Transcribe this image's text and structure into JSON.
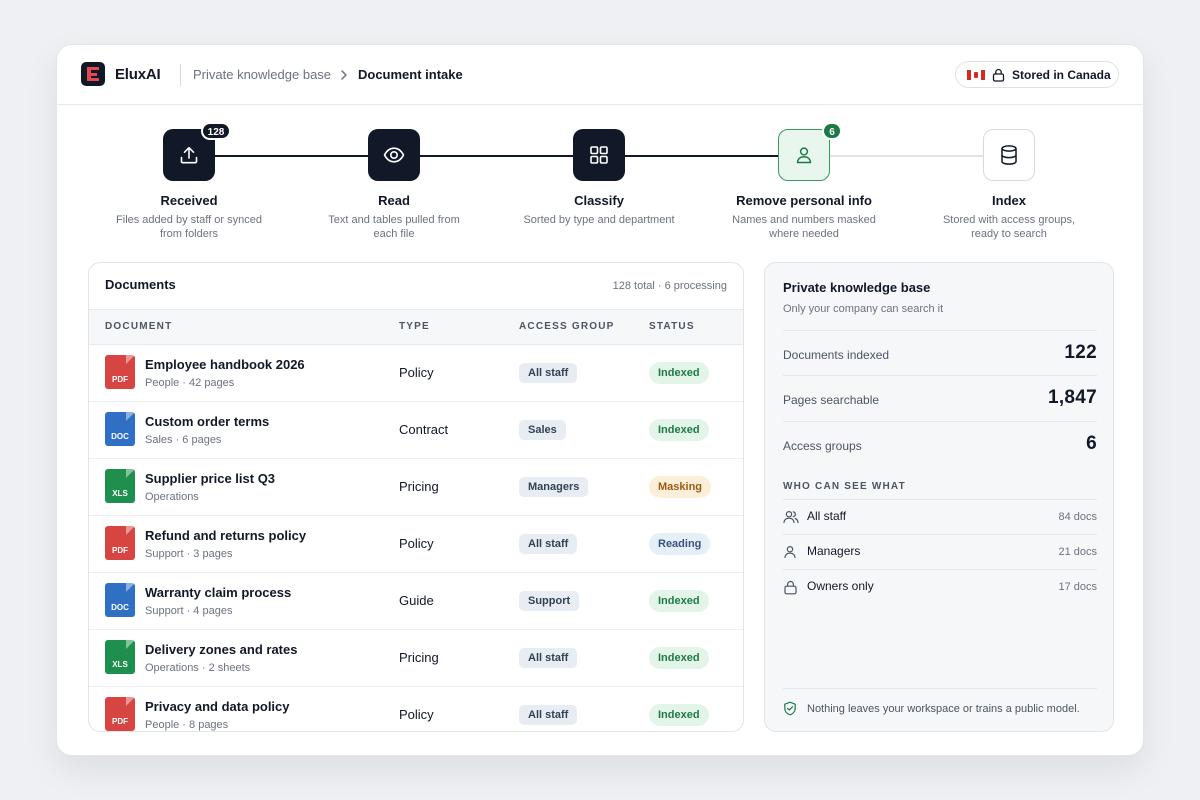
{
  "header": {
    "brand": "EluxAI",
    "breadcrumb": [
      "Private knowledge base",
      "Document intake"
    ],
    "region_badge": "Stored in Canada",
    "logo_icon": "eluxai-logo-icon",
    "flag_icon": "canada-flag-icon"
  },
  "pipeline": {
    "steps": [
      {
        "title": "Received",
        "desc1": "Files added by staff or synced",
        "desc2": "from folders",
        "badge": "128",
        "icon": "upload-icon",
        "state": "done"
      },
      {
        "title": "Read",
        "desc1": "Text and tables pulled from",
        "desc2": "each file",
        "badge": "",
        "icon": "eye-icon",
        "state": "done"
      },
      {
        "title": "Classify",
        "desc1": "Sorted by type and department",
        "desc2": "",
        "badge": "",
        "icon": "grid-icon",
        "state": "done"
      },
      {
        "title": "Remove personal info",
        "desc1": "Names and numbers masked",
        "desc2": "where needed",
        "badge": "6",
        "icon": "person-icon",
        "state": "active"
      },
      {
        "title": "Index",
        "desc1": "Stored with access groups,",
        "desc2": "ready to search",
        "badge": "",
        "icon": "database-icon",
        "state": "pending"
      }
    ]
  },
  "documents": {
    "title": "Documents",
    "summary": "128 total · 6 processing",
    "columns": [
      "DOCUMENT",
      "TYPE",
      "ACCESS GROUP",
      "STATUS"
    ],
    "rows": [
      {
        "file": "PDF",
        "name": "Employee handbook 2026",
        "meta": "People · 42 pages",
        "type": "Policy",
        "access": "All staff",
        "status": "Indexed"
      },
      {
        "file": "DOC",
        "name": "Custom order terms",
        "meta": "Sales · 6 pages",
        "type": "Contract",
        "access": "Sales",
        "status": "Indexed"
      },
      {
        "file": "XLS",
        "name": "Supplier price list Q3",
        "meta": "Operations",
        "type": "Pricing",
        "access": "Managers",
        "status": "Masking"
      },
      {
        "file": "PDF",
        "name": "Refund and returns policy",
        "meta": "Support · 3 pages",
        "type": "Policy",
        "access": "All staff",
        "status": "Reading"
      },
      {
        "file": "DOC",
        "name": "Warranty claim process",
        "meta": "Support · 4 pages",
        "type": "Guide",
        "access": "Support",
        "status": "Indexed"
      },
      {
        "file": "XLS",
        "name": "Delivery zones and rates",
        "meta": "Operations · 2 sheets",
        "type": "Pricing",
        "access": "All staff",
        "status": "Indexed"
      },
      {
        "file": "PDF",
        "name": "Privacy and data policy",
        "meta": "People · 8 pages",
        "type": "Policy",
        "access": "All staff",
        "status": "Indexed"
      }
    ]
  },
  "knowledge_base": {
    "title": "Private knowledge base",
    "subtitle": "Only your company can search it",
    "stats": [
      {
        "label": "Documents indexed",
        "value": "122"
      },
      {
        "label": "Pages searchable",
        "value": "1,847"
      },
      {
        "label": "Access groups",
        "value": "6"
      }
    ],
    "who_heading": "WHO CAN SEE WHAT",
    "groups": [
      {
        "name": "All staff",
        "count": "84 docs",
        "icon": "users-icon"
      },
      {
        "name": "Managers",
        "count": "21 docs",
        "icon": "user-icon"
      },
      {
        "name": "Owners only",
        "count": "17 docs",
        "icon": "lock-icon"
      }
    ],
    "footer": "Nothing leaves your workspace or trains a public model.",
    "footer_icon": "shield-check-icon"
  },
  "colors": {
    "dark": "#111827",
    "accent_green": "#1e7a45",
    "pdf": "#d64541",
    "doc": "#2f6fc4",
    "xls": "#1f8f4e",
    "indexed_bg": "#e3f4e9",
    "indexed_fg": "#1e7a45",
    "masking_bg": "#fcefd9",
    "masking_fg": "#9a5b12",
    "reading_bg": "#e6eef8",
    "reading_fg": "#35557e"
  }
}
